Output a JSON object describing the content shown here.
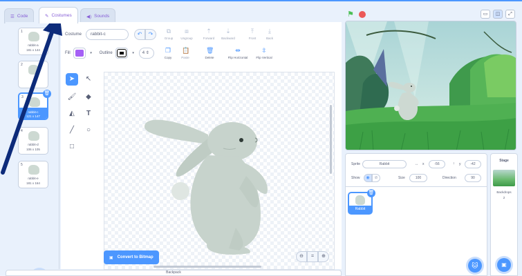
{
  "tabs": [
    {
      "label": "Code",
      "icon": "code-icon"
    },
    {
      "label": "Costumes",
      "icon": "brush-icon"
    },
    {
      "label": "Sounds",
      "icon": "speaker-icon"
    }
  ],
  "costumes": [
    {
      "num": "1",
      "name": "rabbit-a",
      "size": "181 x 144"
    },
    {
      "num": "2",
      "name": "",
      "size": ""
    },
    {
      "num": "3",
      "name": "rabbit-c",
      "size": "121 x 147"
    },
    {
      "num": "4",
      "name": "rabbit-d",
      "size": "106 x 105"
    },
    {
      "num": "5",
      "name": "rabbit-e",
      "size": "181 x 164"
    }
  ],
  "editor": {
    "costume_label": "Costume",
    "costume_name": "rabbit-c",
    "fill_label": "Fill",
    "outline_label": "Outline",
    "outline_width": "4",
    "fill_color": "#a560f5",
    "buttons": {
      "group": "Group",
      "ungroup": "Ungroup",
      "forward": "Forward",
      "backward": "Backward",
      "front": "Front",
      "back": "Back",
      "copy": "Copy",
      "paste": "Paste",
      "delete": "Delete",
      "flip_h": "Flip Horizontal",
      "flip_v": "Flip Vertical"
    },
    "convert": "Convert to Bitmap"
  },
  "backpack": "Backpack",
  "sprite": {
    "sprite_label": "Sprite",
    "name": "Rabbit",
    "x_label": "x",
    "x": "-56",
    "y_label": "y",
    "y": "-42",
    "show_label": "Show",
    "size_label": "Size",
    "size": "100",
    "direction_label": "Direction",
    "direction": "90",
    "tile_label": "Rabbit"
  },
  "stage_pane": {
    "title": "Stage",
    "backdrops_label": "Backdrops",
    "backdrops_count": "2"
  },
  "colors": {
    "accent": "#4c97ff",
    "costume_tab_text": "#855cd6",
    "arrow": "#0d2b7a"
  }
}
